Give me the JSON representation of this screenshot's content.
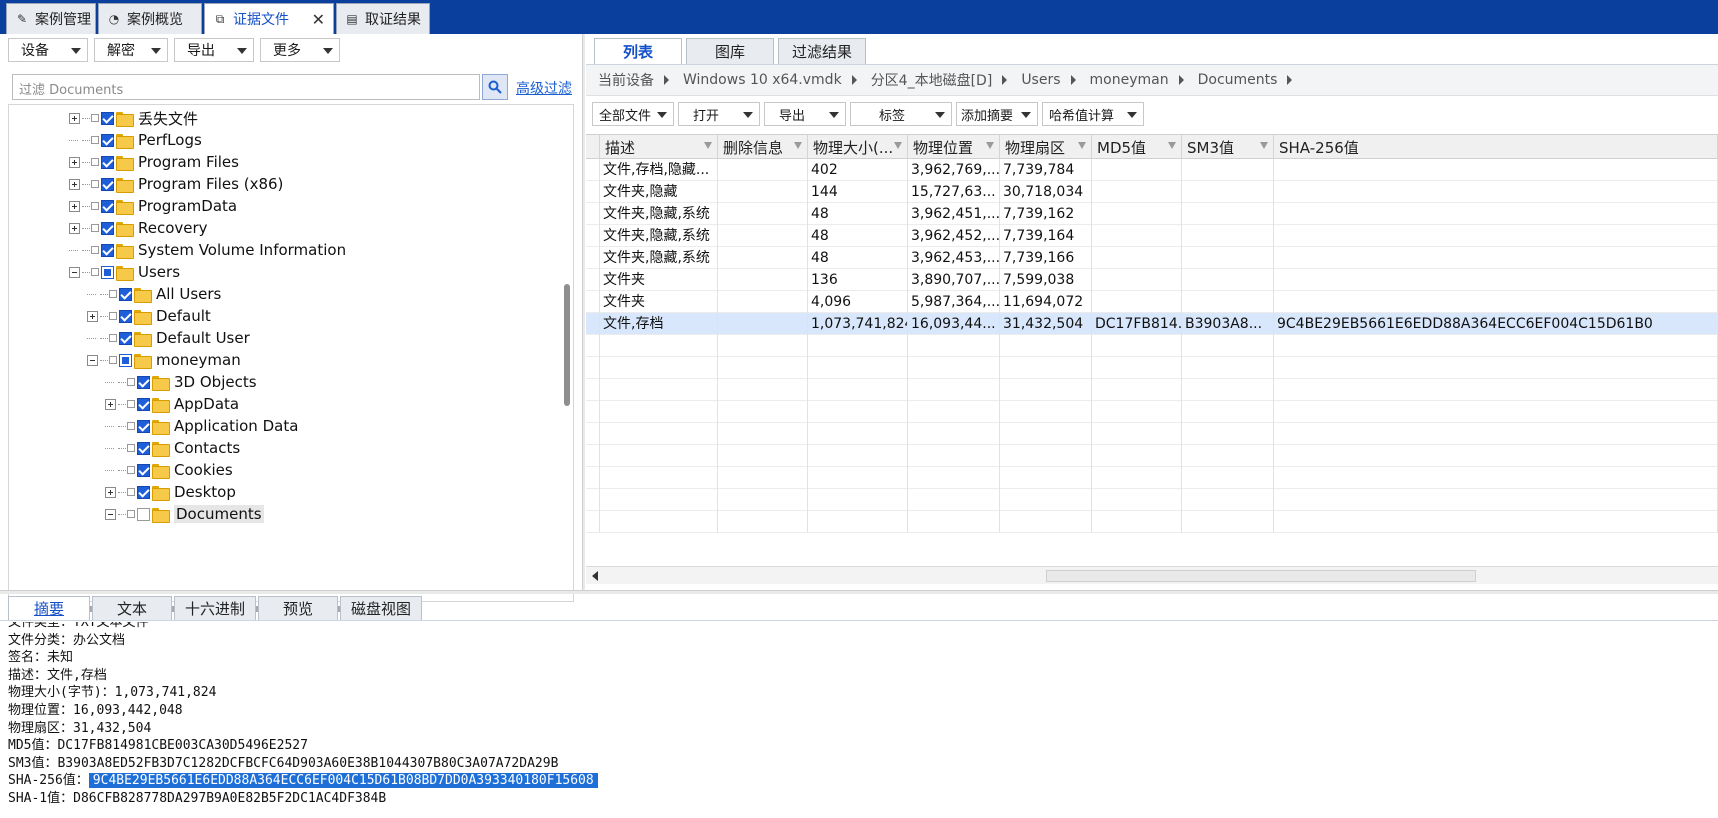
{
  "top_tabs": [
    {
      "label": "案例管理",
      "icon": "edit-icon"
    },
    {
      "label": "案例概览",
      "icon": "chart-icon"
    },
    {
      "label": "证据文件",
      "icon": "copy-icon",
      "active": true
    },
    {
      "label": "取证结果",
      "icon": "result-icon"
    }
  ],
  "left": {
    "menus": [
      "设备",
      "解密",
      "导出",
      "更多"
    ],
    "filter_placeholder": "过滤 Documents",
    "advanced_filter": "高级过滤",
    "tree": [
      {
        "label": "丢失文件",
        "level": 0,
        "exp": "plus",
        "check": "checked"
      },
      {
        "label": "PerfLogs",
        "level": 0,
        "exp": "none",
        "check": "checked"
      },
      {
        "label": "Program Files",
        "level": 0,
        "exp": "plus",
        "check": "checked"
      },
      {
        "label": "Program Files (x86)",
        "level": 0,
        "exp": "plus",
        "check": "checked"
      },
      {
        "label": "ProgramData",
        "level": 0,
        "exp": "plus",
        "check": "checked"
      },
      {
        "label": "Recovery",
        "level": 0,
        "exp": "plus",
        "check": "checked"
      },
      {
        "label": "System Volume Information",
        "level": 0,
        "exp": "none",
        "check": "checked"
      },
      {
        "label": "Users",
        "level": 0,
        "exp": "minus",
        "check": "partial"
      },
      {
        "label": "All Users",
        "level": 1,
        "exp": "none",
        "check": "checked"
      },
      {
        "label": "Default",
        "level": 1,
        "exp": "plus",
        "check": "checked"
      },
      {
        "label": "Default User",
        "level": 1,
        "exp": "none",
        "check": "checked"
      },
      {
        "label": "moneyman",
        "level": 1,
        "exp": "minus",
        "check": "partial"
      },
      {
        "label": "3D Objects",
        "level": 2,
        "exp": "none",
        "check": "checked"
      },
      {
        "label": "AppData",
        "level": 2,
        "exp": "plus",
        "check": "checked"
      },
      {
        "label": "Application Data",
        "level": 2,
        "exp": "none",
        "check": "checked"
      },
      {
        "label": "Contacts",
        "level": 2,
        "exp": "none",
        "check": "checked"
      },
      {
        "label": "Cookies",
        "level": 2,
        "exp": "none",
        "check": "checked"
      },
      {
        "label": "Desktop",
        "level": 2,
        "exp": "plus",
        "check": "checked"
      },
      {
        "label": "Documents",
        "level": 2,
        "exp": "minus",
        "check": "empty",
        "selected": true
      }
    ]
  },
  "right": {
    "view_tabs": [
      "列表",
      "图库",
      "过滤结果"
    ],
    "breadcrumb": [
      "当前设备",
      "Windows 10 x64.vmdk",
      "分区4_本地磁盘[D]",
      "Users",
      "moneyman",
      "Documents"
    ],
    "toolbar": [
      "全部文件",
      "打开",
      "导出",
      "标签",
      "添加摘要",
      "哈希值计算"
    ],
    "columns": [
      "描述",
      "删除信息",
      "物理大小(...",
      "物理位置",
      "物理扇区",
      "MD5值",
      "SM3值",
      "SHA-256值"
    ],
    "rows": [
      [
        "文件,存档,隐藏...",
        "",
        "402",
        "3,962,769,...",
        "7,739,784",
        "",
        "",
        ""
      ],
      [
        "文件夹,隐藏",
        "",
        "144",
        "15,727,63...",
        "30,718,034",
        "",
        "",
        ""
      ],
      [
        "文件夹,隐藏,系统",
        "",
        "48",
        "3,962,451,...",
        "7,739,162",
        "",
        "",
        ""
      ],
      [
        "文件夹,隐藏,系统",
        "",
        "48",
        "3,962,452,...",
        "7,739,164",
        "",
        "",
        ""
      ],
      [
        "文件夹,隐藏,系统",
        "",
        "48",
        "3,962,453,...",
        "7,739,166",
        "",
        "",
        ""
      ],
      [
        "文件夹",
        "",
        "136",
        "3,890,707,...",
        "7,599,038",
        "",
        "",
        ""
      ],
      [
        "文件夹",
        "",
        "4,096",
        "5,987,364,...",
        "11,694,072",
        "",
        "",
        ""
      ],
      [
        "文件,存档",
        "",
        "1,073,741,824",
        "16,093,44...",
        "31,432,504",
        "DC17FB814...",
        "B3903A8...",
        "9C4BE29EB5661E6EDD88A364ECC6EF004C15D61B0"
      ]
    ]
  },
  "bottom": {
    "tabs": [
      "摘要",
      "文本",
      "十六进制",
      "预览",
      "磁盘视图"
    ],
    "lines": [
      {
        "label": "文件类型：",
        "value": "TXT文本文件"
      },
      {
        "label": "文件分类：",
        "value": "办公文档"
      },
      {
        "label": "签名：",
        "value": "未知"
      },
      {
        "label": "描述：",
        "value": "文件,存档"
      },
      {
        "label": "物理大小(字节)：",
        "value": "1,073,741,824"
      },
      {
        "label": "物理位置：",
        "value": "16,093,442,048"
      },
      {
        "label": "物理扇区：",
        "value": "31,432,504"
      },
      {
        "label": "MD5值：",
        "value": "DC17FB814981CBE003CA30D5496E2527"
      },
      {
        "label": "SM3值：",
        "value": "B3903A8ED52FB3D7C1282DCFBCFC64D903A60E38B1044307B80C3A07A72DA29B"
      },
      {
        "label": "SHA-256值：",
        "value": "9C4BE29EB5661E6EDD88A364ECC6EF004C15D61B08BD7DD0A393340180F15608",
        "highlight": true
      },
      {
        "label": "SHA-1值：",
        "value": "D86CFB828778DA297B9A0E82B5F2DC1AC4DF384B"
      }
    ]
  }
}
